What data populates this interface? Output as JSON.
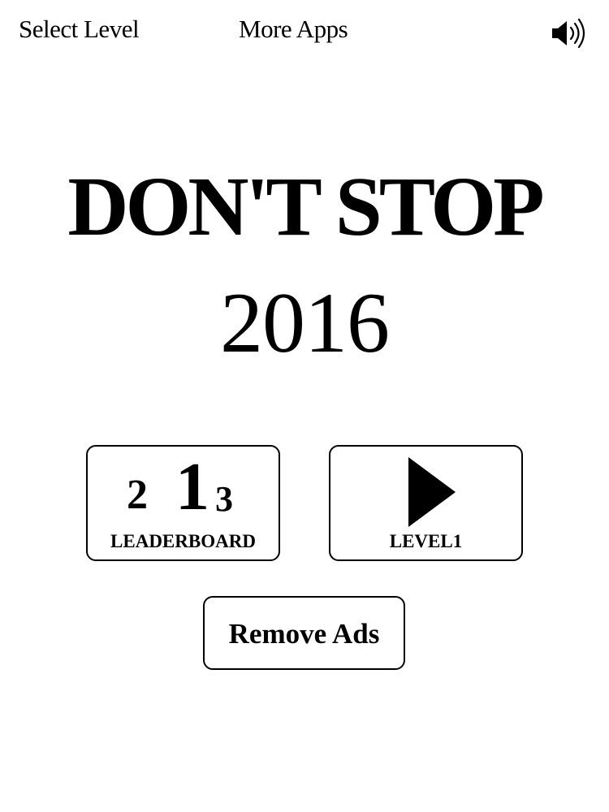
{
  "header": {
    "select_level_label": "Select Level",
    "more_apps_label": "More Apps",
    "sound_icon": "speaker-icon"
  },
  "title": {
    "line1": "DON'T STOP",
    "line2": "2016"
  },
  "leaderboard": {
    "ranks": {
      "first": "1",
      "second": "2",
      "third": "3"
    },
    "label": "LEADERBOARD"
  },
  "play": {
    "icon": "play-icon",
    "label": "LEVEL1"
  },
  "remove_ads": {
    "label": "Remove Ads"
  },
  "colors": {
    "background": "#ffffff",
    "foreground": "#000000"
  }
}
